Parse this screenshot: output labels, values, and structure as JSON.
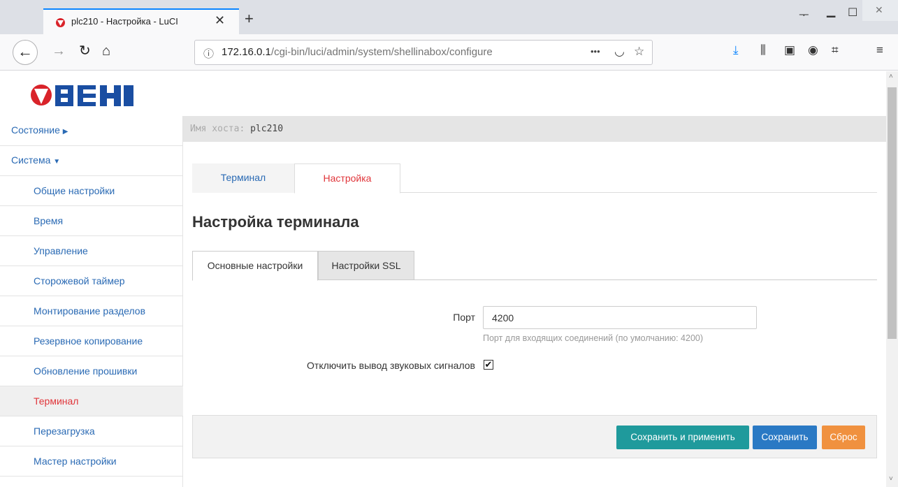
{
  "browser": {
    "tab_title": "plc210 - Настройка - LuCI",
    "tab_close": "✕",
    "new_tab": "+",
    "url_host": "172.16.0.1",
    "url_path": "/cgi-bin/luci/admin/system/shellinabox/configure",
    "url_more": "•••",
    "icons": [
      "back-icon",
      "forward-icon",
      "reload-icon",
      "home-icon",
      "info-icon",
      "pocket-icon",
      "bookmark-star-icon",
      "download-icon",
      "library-icon",
      "sidebar-icon",
      "account-icon",
      "crop-icon",
      "menu-icon"
    ]
  },
  "logo": {
    "text": "ОВЕН",
    "colors": {
      "red": "#d9232a",
      "blue": "#1a4ea2"
    }
  },
  "sidebar": {
    "status": "Состояние",
    "system": "Система",
    "items": [
      {
        "label": "Общие настройки"
      },
      {
        "label": "Время"
      },
      {
        "label": "Управление"
      },
      {
        "label": "Сторожевой таймер"
      },
      {
        "label": "Монтирование разделов"
      },
      {
        "label": "Резервное копирование"
      },
      {
        "label": "Обновление прошивки"
      },
      {
        "label": "Терминал",
        "active": true
      },
      {
        "label": "Перезагрузка"
      },
      {
        "label": "Мастер настройки"
      }
    ]
  },
  "hostbar": {
    "label": "Имя хоста:",
    "value": "plc210"
  },
  "main_tabs": [
    {
      "label": "Терминал"
    },
    {
      "label": "Настройка",
      "active": true
    }
  ],
  "page_title": "Настройка терминала",
  "sub_tabs": [
    {
      "label": "Основные настройки",
      "active": true
    },
    {
      "label": "Настройки SSL"
    }
  ],
  "form": {
    "port_label": "Порт",
    "port_value": "4200",
    "port_hint": "Порт для входящих соединений (по умолчанию: 4200)",
    "beep_label": "Отключить вывод звуковых сигналов",
    "beep_checked": true
  },
  "actions": {
    "save_apply": "Сохранить и применить",
    "save": "Сохранить",
    "reset": "Сброс"
  },
  "colors": {
    "link": "#2a6ab4",
    "active": "#e0353a",
    "save_apply": "#1f9a9c",
    "save": "#2a79c4",
    "reset": "#f0913f"
  }
}
